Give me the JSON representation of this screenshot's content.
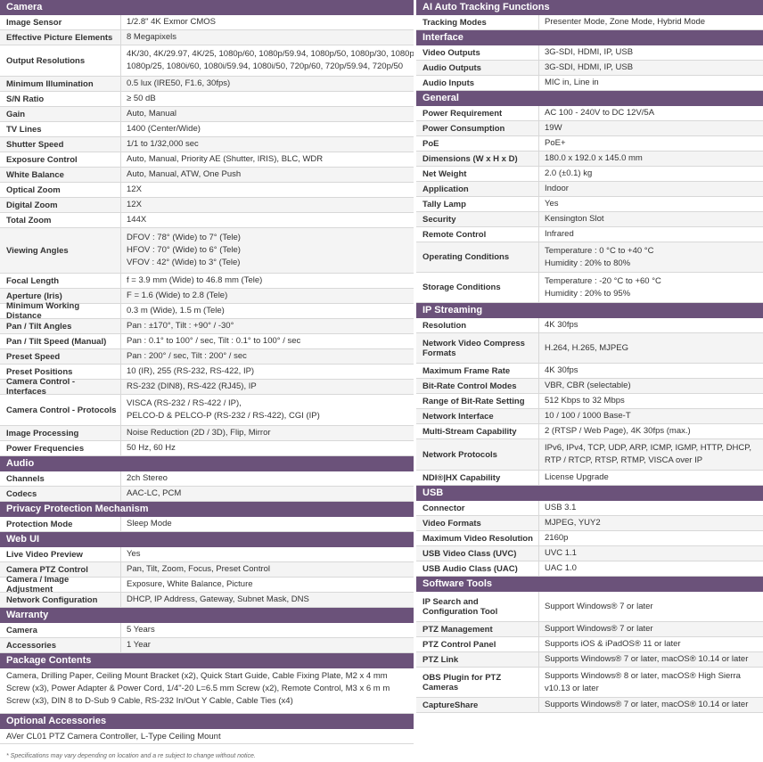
{
  "colors": {
    "section_header": "#6b527a",
    "row_alt": "#f4f4f4",
    "border": "#d8d8d8"
  },
  "footnote": "* Specifications may vary depending on location and a re subject to change without notice.",
  "left": [
    {
      "title": "Camera",
      "rows": [
        {
          "label": "Image Sensor",
          "value": [
            "1/2.8\" 4K Exmor CMOS"
          ],
          "h": 17
        },
        {
          "label": "Effective Picture Elements",
          "value": [
            "8 Megapixels"
          ],
          "h": 17
        },
        {
          "label": "Output Resolutions",
          "value": [
            "4K/30, 4K/29.97, 4K/25, 1080p/60, 1080p/59.94, 1080p/50, 1080p/30, 1080p/29.97,",
            "1080p/25, 1080i/60, 1080i/59.94, 1080i/50, 720p/60, 720p/59.94, 720p/50"
          ],
          "h": 35
        },
        {
          "label": "Minimum Illumination",
          "value": [
            "0.5 lux (IRE50, F1.6, 30fps)"
          ],
          "h": 17
        },
        {
          "label": "S/N Ratio",
          "value": [
            "≥ 50 dB"
          ],
          "h": 17
        },
        {
          "label": "Gain",
          "value": [
            "Auto, Manual"
          ],
          "h": 17
        },
        {
          "label": "TV Lines",
          "value": [
            "1400 (Center/Wide)"
          ],
          "h": 17
        },
        {
          "label": "Shutter Speed",
          "value": [
            "1/1 to 1/32,000 sec"
          ],
          "h": 17
        },
        {
          "label": "Exposure Control",
          "value": [
            "Auto, Manual, Priority AE (Shutter, IRIS), BLC, WDR"
          ],
          "h": 17
        },
        {
          "label": "White Balance",
          "value": [
            "Auto, Manual, ATW, One Push"
          ],
          "h": 17
        },
        {
          "label": "Optical Zoom",
          "value": [
            "12X"
          ],
          "h": 17
        },
        {
          "label": "Digital Zoom",
          "value": [
            "12X"
          ],
          "h": 17
        },
        {
          "label": "Total Zoom",
          "value": [
            "144X"
          ],
          "h": 17
        },
        {
          "label": "Viewing Angles",
          "value": [
            "DFOV : 78° (Wide) to 7° (Tele)",
            "HFOV : 70° (Wide) to 6° (Tele)",
            "VFOV : 42° (Wide) to 3° (Tele)"
          ],
          "h": 51
        },
        {
          "label": "Focal Length",
          "value": [
            "f = 3.9 mm (Wide) to 46.8 mm (Tele)"
          ],
          "h": 17
        },
        {
          "label": "Aperture (Iris)",
          "value": [
            "F = 1.6 (Wide) to 2.8 (Tele)"
          ],
          "h": 17
        },
        {
          "label": "Minimum Working Distance",
          "value": [
            "0.3 m (Wide), 1.5 m (Tele)"
          ],
          "h": 17
        },
        {
          "label": "Pan / Tilt Angles",
          "value": [
            "Pan : ±170°, Tilt : +90° / -30°"
          ],
          "h": 17
        },
        {
          "label": "Pan / Tilt Speed (Manual)",
          "value": [
            "Pan : 0.1° to 100° / sec, Tilt : 0.1° to 100° / sec"
          ],
          "h": 17
        },
        {
          "label": "Preset Speed",
          "value": [
            "Pan : 200° / sec, Tilt : 200° / sec"
          ],
          "h": 17
        },
        {
          "label": "Preset Positions",
          "value": [
            "10 (IR), 255 (RS-232, RS-422, IP)"
          ],
          "h": 17
        },
        {
          "label": "Camera Control - Interfaces",
          "value": [
            "RS-232 (DIN8), RS-422 (RJ45), IP"
          ],
          "h": 17
        },
        {
          "label": "Camera Control - Protocols",
          "value": [
            "VISCA (RS-232 / RS-422 / IP),",
            "PELCO-D & PELCO-P (RS-232 / RS-422), CGI (IP)"
          ],
          "h": 35
        },
        {
          "label": "Image Processing",
          "value": [
            "Noise Reduction (2D / 3D), Flip, Mirror"
          ],
          "h": 17
        },
        {
          "label": "Power Frequencies",
          "value": [
            "50 Hz, 60 Hz"
          ],
          "h": 17
        }
      ]
    },
    {
      "title": "Audio",
      "rows": [
        {
          "label": "Channels",
          "value": [
            "2ch Stereo"
          ],
          "h": 17
        },
        {
          "label": "Codecs",
          "value": [
            "AAC-LC, PCM"
          ],
          "h": 17
        }
      ]
    },
    {
      "title": "Privacy Protection Mechanism",
      "rows": [
        {
          "label": "Protection Mode",
          "value": [
            "Sleep Mode"
          ],
          "h": 17
        }
      ]
    },
    {
      "title": "Web UI",
      "rows": [
        {
          "label": "Live Video Preview",
          "value": [
            "Yes"
          ],
          "h": 17
        },
        {
          "label": "Camera PTZ Control",
          "value": [
            "Pan, Tilt, Zoom, Focus, Preset Control"
          ],
          "h": 17
        },
        {
          "label": "Camera / Image Adjustment",
          "value": [
            "Exposure, White Balance, Picture"
          ],
          "h": 17
        },
        {
          "label": "Network Configuration",
          "value": [
            "DHCP, IP Address, Gateway, Subnet Mask, DNS"
          ],
          "h": 17
        }
      ]
    },
    {
      "title": "Warranty",
      "rows": [
        {
          "label": "Camera",
          "value": [
            "5 Years"
          ],
          "h": 17
        },
        {
          "label": "Accessories",
          "value": [
            "1 Year"
          ],
          "h": 17
        }
      ]
    },
    {
      "title": "Package Contents",
      "full": [
        "Camera, Drilling Paper, Ceiling Mount Bracket (x2), Quick Start Guide, Cable Fixing Plate, M2 x 4 mm",
        "Screw (x3), Power Adapter & Power Cord, 1/4\"-20 L=6.5 mm Screw (x2), Remote Control, M3 x 6 m m",
        "Screw (x3), DIN 8 to D-Sub 9 Cable, RS-232 In/Out Y Cable, Cable Ties (x4)"
      ],
      "h": 51
    },
    {
      "title": "Optional Accessories",
      "full": [
        "AVer CL01 PTZ Camera Controller, L-Type Ceiling Mount"
      ],
      "h": 17
    }
  ],
  "right": [
    {
      "title": "AI Auto Tracking Functions",
      "rows": [
        {
          "label": "Tracking Modes",
          "value": [
            "Presenter Mode, Zone Mode, Hybrid Mode"
          ],
          "h": 17
        }
      ]
    },
    {
      "title": "Interface",
      "rows": [
        {
          "label": "Video Outputs",
          "value": [
            "3G-SDI, HDMI, IP, USB"
          ],
          "h": 17
        },
        {
          "label": "Audio Outputs",
          "value": [
            "3G-SDI, HDMI, IP, USB"
          ],
          "h": 17
        },
        {
          "label": "Audio Inputs",
          "value": [
            "MIC in, Line in"
          ],
          "h": 17
        }
      ]
    },
    {
      "title": "General",
      "rows": [
        {
          "label": "Power Requirement",
          "value": [
            "AC 100 - 240V to DC 12V/5A"
          ],
          "h": 17
        },
        {
          "label": "Power Consumption",
          "value": [
            "19W"
          ],
          "h": 17
        },
        {
          "label": "PoE",
          "value": [
            "PoE+"
          ],
          "h": 17
        },
        {
          "label": "Dimensions (W x H x D)",
          "value": [
            "180.0 x 192.0 x 145.0 mm"
          ],
          "h": 17
        },
        {
          "label": "Net Weight",
          "value": [
            "2.0 (±0.1) kg"
          ],
          "h": 17
        },
        {
          "label": "Application",
          "value": [
            "Indoor"
          ],
          "h": 17
        },
        {
          "label": "Tally Lamp",
          "value": [
            "Yes"
          ],
          "h": 17
        },
        {
          "label": "Security",
          "value": [
            "Kensington Slot"
          ],
          "h": 17
        },
        {
          "label": "Remote Control",
          "value": [
            "Infrared"
          ],
          "h": 17
        },
        {
          "label": "Operating Conditions",
          "value": [
            "Temperature : 0 °C to +40 °C",
            "Humidity : 20% to 80%"
          ],
          "h": 34
        },
        {
          "label": "Storage Conditions",
          "value": [
            "Temperature : -20 °C to +60 °C",
            "Humidity : 20% to 95%"
          ],
          "h": 34
        }
      ]
    },
    {
      "title": "IP Streaming",
      "rows": [
        {
          "label": "Resolution",
          "value": [
            "4K 30fps"
          ],
          "h": 17
        },
        {
          "label": "Network Video Compress Formats",
          "value": [
            "H.264, H.265, MJPEG"
          ],
          "h": 34
        },
        {
          "label": "Maximum Frame Rate",
          "value": [
            "4K 30fps"
          ],
          "h": 17
        },
        {
          "label": "Bit-Rate Control Modes",
          "value": [
            "VBR, CBR (selectable)"
          ],
          "h": 17
        },
        {
          "label": "Range of Bit-Rate Setting",
          "value": [
            "512 Kbps to 32 Mbps"
          ],
          "h": 17
        },
        {
          "label": "Network Interface",
          "value": [
            "10 / 100 / 1000 Base-T"
          ],
          "h": 17
        },
        {
          "label": "Multi-Stream Capability",
          "value": [
            "2 (RTSP / Web Page), 4K 30fps (max.)"
          ],
          "h": 17
        },
        {
          "label": "Network Protocols",
          "value": [
            "IPv6, IPv4, TCP, UDP, ARP, ICMP, IGMP, HTTP, DHCP,",
            "RTP / RTCP, RTSP, RTMP, VISCA over IP"
          ],
          "h": 35
        },
        {
          "label": "NDI®|HX Capability",
          "value": [
            "License Upgrade"
          ],
          "h": 17
        }
      ]
    },
    {
      "title": "USB",
      "rows": [
        {
          "label": "Connector",
          "value": [
            "USB 3.1"
          ],
          "h": 17
        },
        {
          "label": "Video Formats",
          "value": [
            "MJPEG, YUY2"
          ],
          "h": 17
        },
        {
          "label": "Maximum Video Resolution",
          "value": [
            "2160p"
          ],
          "h": 17
        },
        {
          "label": "USB Video Class (UVC)",
          "value": [
            "UVC 1.1"
          ],
          "h": 17
        },
        {
          "label": "USB Audio Class (UAC)",
          "value": [
            "UAC 1.0"
          ],
          "h": 17
        }
      ]
    },
    {
      "title": "Software Tools",
      "rows": [
        {
          "label": "IP Search and Configuration Tool",
          "value": [
            "Support Windows® 7 or later"
          ],
          "h": 34
        },
        {
          "label": "PTZ Management",
          "value": [
            "Support Windows® 7 or later"
          ],
          "h": 17
        },
        {
          "label": "PTZ Control Panel",
          "value": [
            "Supports iOS & iPadOS® 11 or later"
          ],
          "h": 17
        },
        {
          "label": "PTZ Link",
          "value": [
            "Supports Windows® 7 or later, macOS® 10.14 or later"
          ],
          "h": 17
        },
        {
          "label": "OBS Plugin for PTZ Cameras",
          "value": [
            "Supports Windows® 8 or later, macOS® High Sierra",
            "v10.13 or later"
          ],
          "h": 34
        },
        {
          "label": "CaptureShare",
          "value": [
            "Supports Windows® 7 or later, macOS® 10.14 or later"
          ],
          "h": 17
        }
      ]
    }
  ]
}
